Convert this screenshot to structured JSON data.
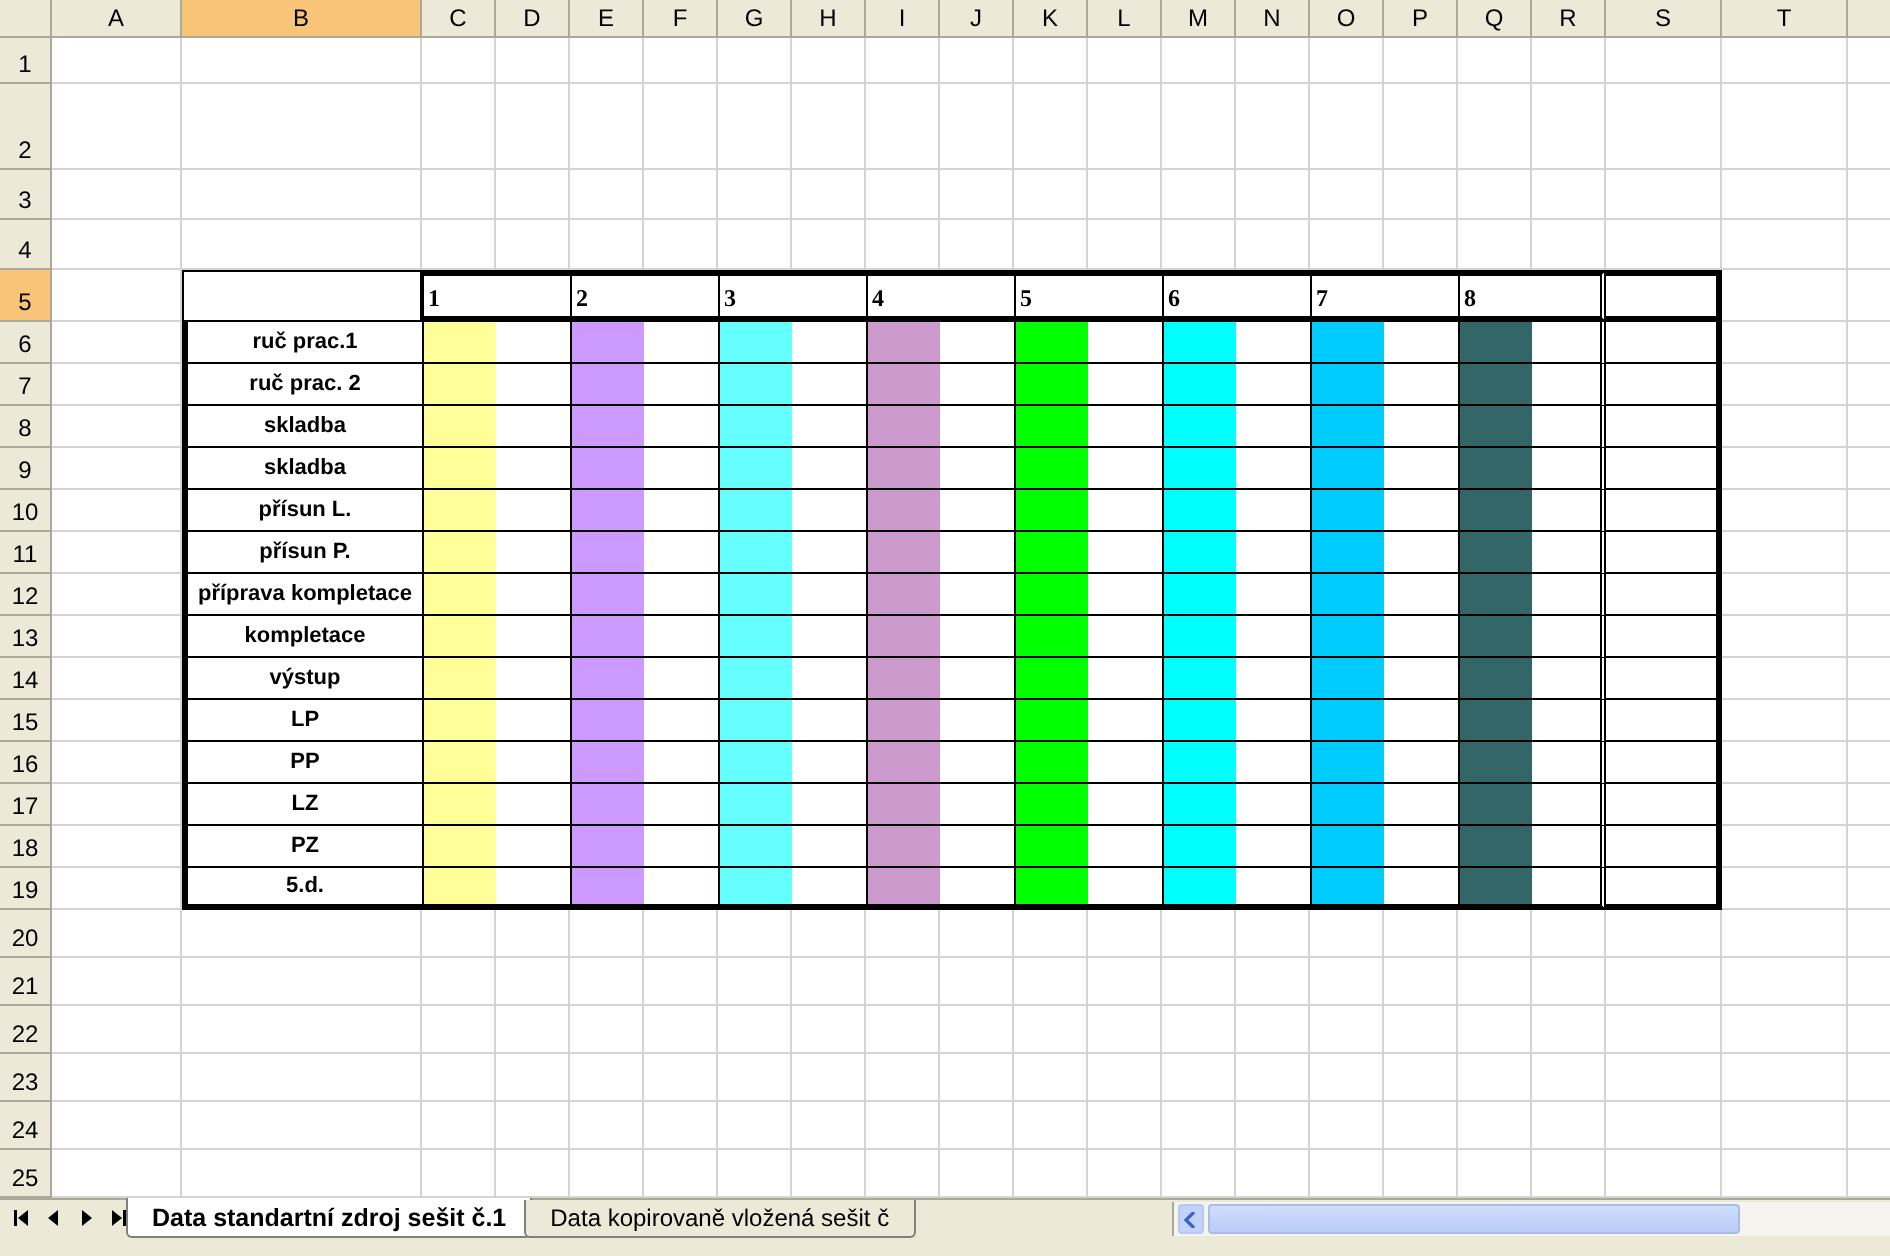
{
  "columns": [
    {
      "label": "A",
      "selected": false
    },
    {
      "label": "B",
      "selected": true
    },
    {
      "label": "C",
      "selected": false
    },
    {
      "label": "D",
      "selected": false
    },
    {
      "label": "E",
      "selected": false
    },
    {
      "label": "F",
      "selected": false
    },
    {
      "label": "G",
      "selected": false
    },
    {
      "label": "H",
      "selected": false
    },
    {
      "label": "I",
      "selected": false
    },
    {
      "label": "J",
      "selected": false
    },
    {
      "label": "K",
      "selected": false
    },
    {
      "label": "L",
      "selected": false
    },
    {
      "label": "M",
      "selected": false
    },
    {
      "label": "N",
      "selected": false
    },
    {
      "label": "O",
      "selected": false
    },
    {
      "label": "P",
      "selected": false
    },
    {
      "label": "Q",
      "selected": false
    },
    {
      "label": "R",
      "selected": false
    },
    {
      "label": "S",
      "selected": false
    },
    {
      "label": "T",
      "selected": false
    }
  ],
  "rows": [
    {
      "label": "1",
      "selected": false
    },
    {
      "label": "2",
      "selected": false
    },
    {
      "label": "3",
      "selected": false
    },
    {
      "label": "4",
      "selected": false
    },
    {
      "label": "5",
      "selected": true
    },
    {
      "label": "6",
      "selected": false
    },
    {
      "label": "7",
      "selected": false
    },
    {
      "label": "8",
      "selected": false
    },
    {
      "label": "9",
      "selected": false
    },
    {
      "label": "10",
      "selected": false
    },
    {
      "label": "11",
      "selected": false
    },
    {
      "label": "12",
      "selected": false
    },
    {
      "label": "13",
      "selected": false
    },
    {
      "label": "14",
      "selected": false
    },
    {
      "label": "15",
      "selected": false
    },
    {
      "label": "16",
      "selected": false
    },
    {
      "label": "17",
      "selected": false
    },
    {
      "label": "18",
      "selected": false
    },
    {
      "label": "19",
      "selected": false
    },
    {
      "label": "20",
      "selected": false
    },
    {
      "label": "21",
      "selected": false
    },
    {
      "label": "22",
      "selected": false
    },
    {
      "label": "23",
      "selected": false
    },
    {
      "label": "24",
      "selected": false
    },
    {
      "label": "25",
      "selected": false
    }
  ],
  "table": {
    "groups": [
      {
        "label": "1",
        "color": "#ffff99"
      },
      {
        "label": "2",
        "color": "#cc99ff"
      },
      {
        "label": "3",
        "color": "#66ffff"
      },
      {
        "label": "4",
        "color": "#cc99cc"
      },
      {
        "label": "5",
        "color": "#00ff00"
      },
      {
        "label": "6",
        "color": "#00ffff"
      },
      {
        "label": "7",
        "color": "#00ccff"
      },
      {
        "label": "8",
        "color": "#336666"
      }
    ],
    "row_labels": [
      "ruč prac.1",
      "ruč prac. 2",
      "skladba",
      "skladba",
      "přísun L.",
      "přísun P.",
      "příprava kompletace",
      "kompletace",
      "výstup",
      "LP",
      "PP",
      "LZ",
      "PZ",
      "5.d."
    ]
  },
  "sheet_tabs": [
    {
      "label": "Data standartní zdroj sešit č.1",
      "selected": true
    },
    {
      "label": "Data kopirovaně vložená sešit č",
      "selected": false
    }
  ]
}
